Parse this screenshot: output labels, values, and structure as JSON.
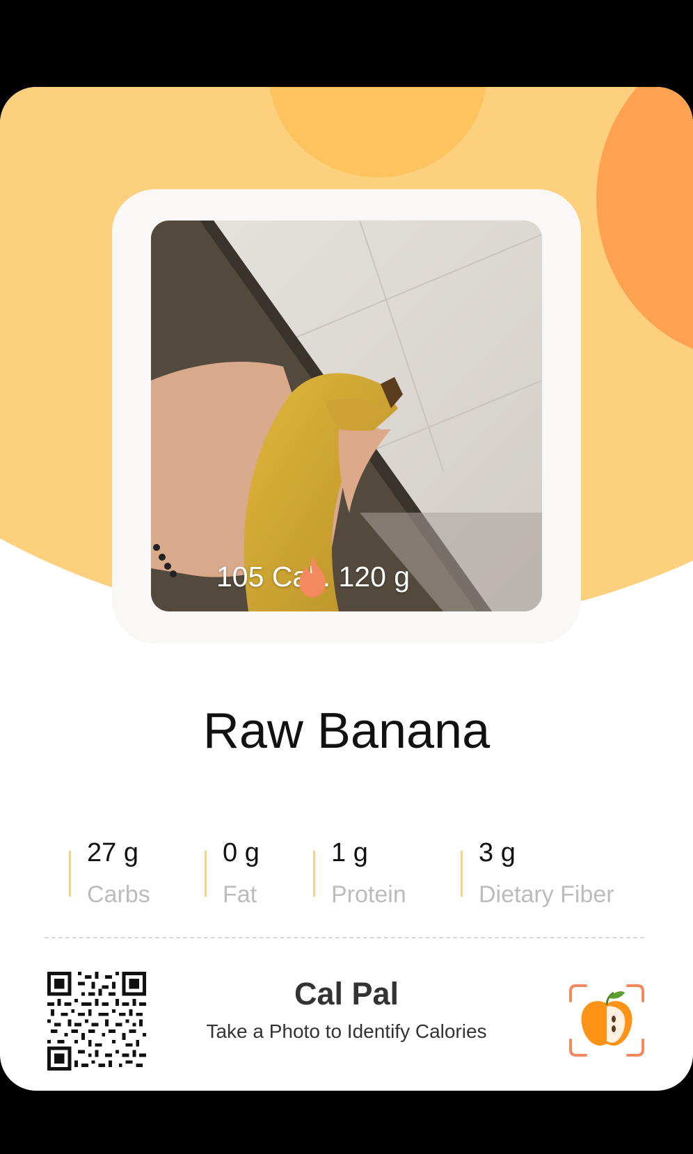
{
  "photo": {
    "calories": "105 Cal . 120 g"
  },
  "food": {
    "name": "Raw Banana"
  },
  "nutrients": [
    {
      "value": "27 g",
      "label": "Carbs"
    },
    {
      "value": "0 g",
      "label": "Fat"
    },
    {
      "value": "1 g",
      "label": "Protein"
    },
    {
      "value": "3 g",
      "label": "Dietary Fiber"
    }
  ],
  "footer": {
    "app_name": "Cal Pal",
    "tagline": "Take a Photo to Identify Calories",
    "qr_icon": "qr-code",
    "logo_icon": "apple-scan-logo"
  },
  "colors": {
    "background_yellow": "#fdd07e",
    "accent_orange": "#fea252",
    "flame": "#f4895f"
  }
}
